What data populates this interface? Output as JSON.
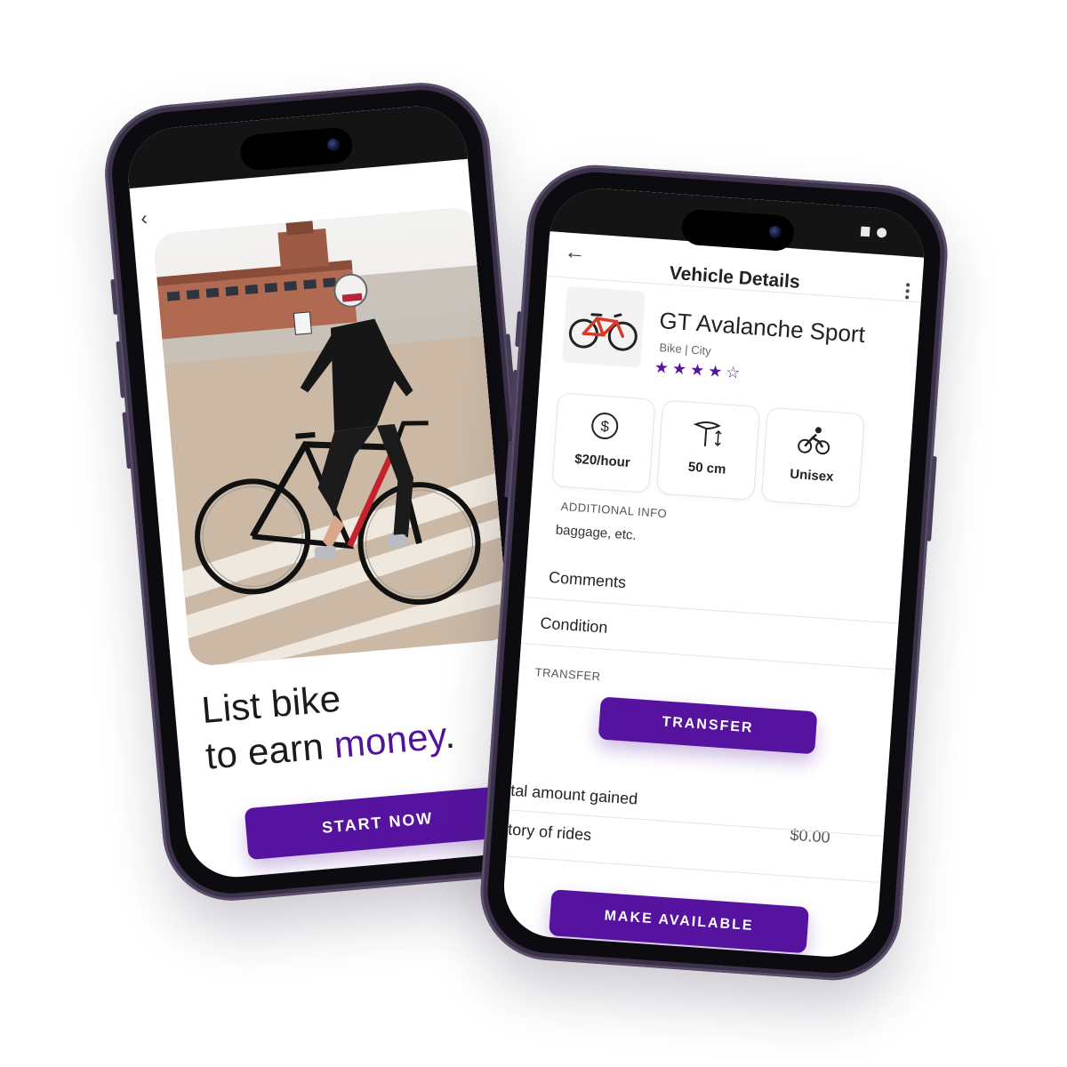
{
  "onboarding": {
    "headline_line1": "List bike",
    "headline_line2_prefix": "to earn ",
    "headline_accent": "money",
    "headline_suffix": ".",
    "cta_label": "START NOW",
    "back_glyph": "‹"
  },
  "vehicle_details": {
    "title": "Vehicle Details",
    "back_glyph": "←",
    "vehicle": {
      "name": "GT Avalanche Sport",
      "meta": "Bike | City",
      "rating": 4,
      "rating_max": 5
    },
    "specs": [
      {
        "icon": "dollar-icon",
        "label": "$20/hour"
      },
      {
        "icon": "bike-seat-icon",
        "label": "50 cm"
      },
      {
        "icon": "cyclist-icon",
        "label": "Unisex"
      }
    ],
    "additional_info": {
      "caption": "ADDITIONAL INFO",
      "text": "baggage, etc."
    },
    "rows": {
      "comments": "Comments",
      "condition": "Condition"
    },
    "transfer": {
      "caption": "TRANSFER",
      "button_label": "TRANSFER"
    },
    "total_amount": {
      "label": "tal amount gained",
      "value": "$0.00"
    },
    "history_label": "tory of rides",
    "make_available_label": "MAKE AVAILABLE"
  },
  "colors": {
    "accent": "#55139f",
    "phone_frame": "#3b3149"
  }
}
